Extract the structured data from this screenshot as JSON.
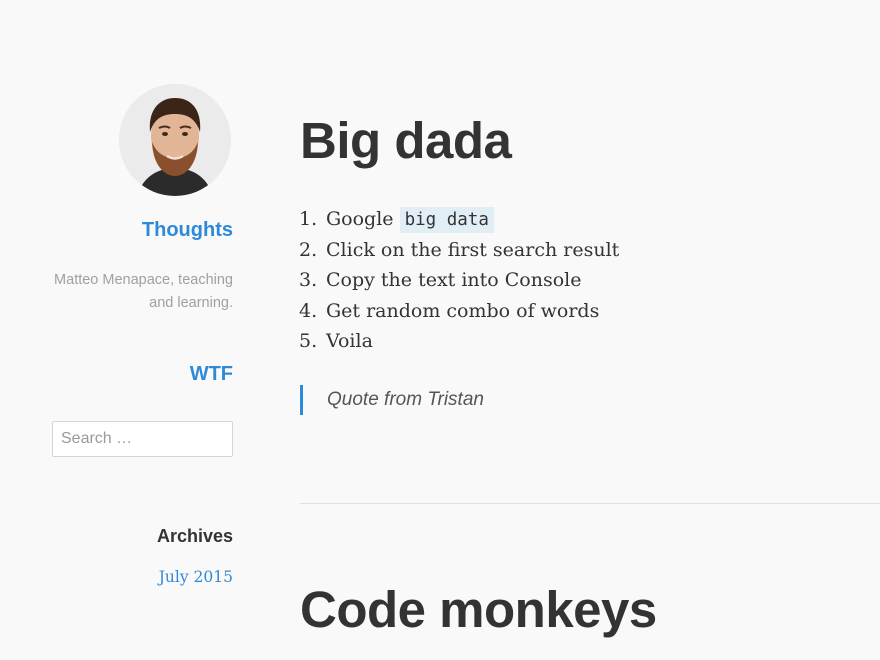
{
  "sidebar": {
    "avatar_alt": "Matteo Menapace",
    "site_title": "Thoughts",
    "description": "Matteo Menapace, teaching and learning.",
    "nav_link": "WTF",
    "search": {
      "placeholder": "Search …"
    },
    "archives": {
      "title": "Archives",
      "links": [
        "July 2015"
      ]
    }
  },
  "main": {
    "posts": [
      {
        "title": "Big dada",
        "steps": [
          {
            "number": "1.",
            "text": "Google ",
            "code": "big data"
          },
          {
            "number": "2.",
            "text": "Click on the first search result"
          },
          {
            "number": "3.",
            "text": "Copy the text into Console"
          },
          {
            "number": "4.",
            "text": "Get random combo of words"
          },
          {
            "number": "5.",
            "text": "Voila"
          }
        ],
        "quote": "Quote from Tristan"
      },
      {
        "title": "Code monkeys"
      }
    ]
  },
  "colors": {
    "accent": "#2e8ad8",
    "text": "#333333",
    "muted": "#a0a0a0",
    "code_bg": "#e2eef6",
    "background": "#f9f9f9"
  }
}
